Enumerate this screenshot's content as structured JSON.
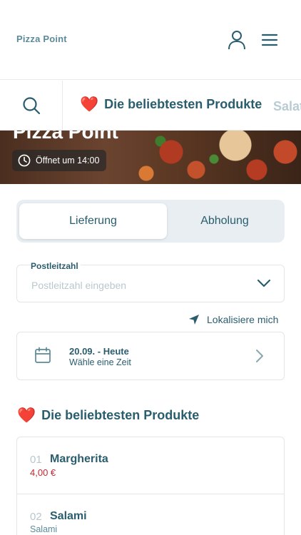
{
  "header": {
    "logo": "Pizza Point",
    "icons": {
      "user": "user-icon",
      "menu": "hamburger-menu-icon"
    }
  },
  "categories": {
    "search_icon": "search-icon",
    "active": {
      "emoji": "❤️",
      "label": "Die beliebtesten Produkte"
    },
    "next": {
      "label": "Salat"
    }
  },
  "hero": {
    "title": "Pizza Point",
    "opening": "Öffnet um 14:00",
    "clock_icon": "clock-icon"
  },
  "order_mode": {
    "options": [
      "Lieferung",
      "Abholung"
    ],
    "selected": "Lieferung"
  },
  "postcode": {
    "label": "Postleitzahl",
    "placeholder": "Postleitzahl eingeben",
    "value": ""
  },
  "locate": {
    "label": "Lokalisiere mich",
    "icon": "location-arrow-icon"
  },
  "delivery_time": {
    "date": "20.09. - Heute",
    "hint": "Wähle eine Zeit",
    "icon": "calendar-icon"
  },
  "section": {
    "emoji": "❤️",
    "title": "Die beliebtesten Produkte"
  },
  "products": [
    {
      "number": "01",
      "name": "Margherita",
      "price": "4,00 €"
    },
    {
      "number": "02",
      "name": "Salami",
      "description": "Salami"
    }
  ],
  "colors": {
    "primary": "#2a5d6e",
    "muted": "#b9c8ce",
    "price": "#c8262f",
    "toggle_bg": "#e8eef1"
  }
}
